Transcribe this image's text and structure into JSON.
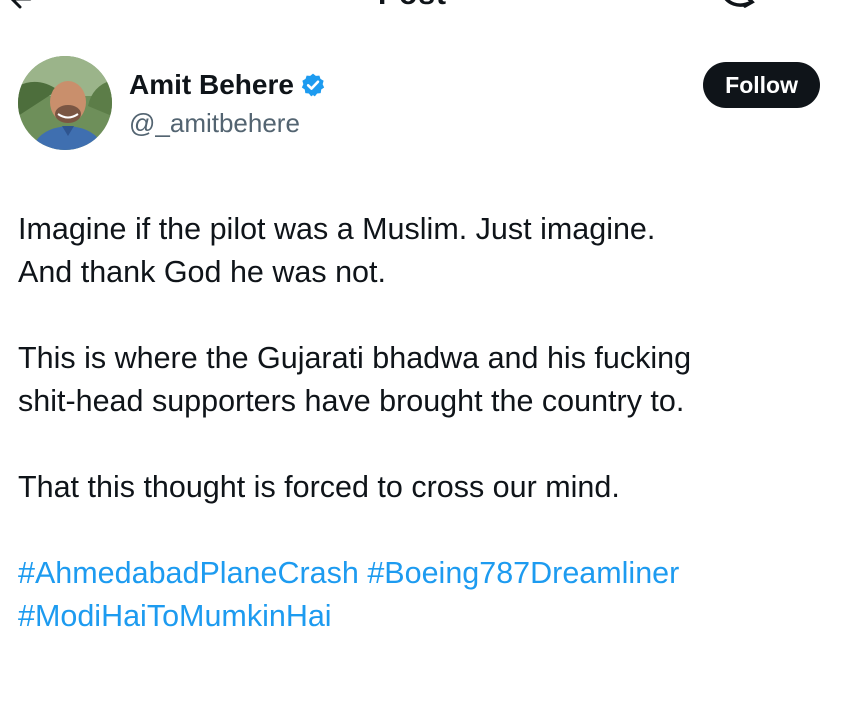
{
  "header": {
    "title": "Post"
  },
  "author": {
    "display_name": "Amit Behere",
    "handle": "@_amitbehere",
    "verified": true,
    "follow_label": "Follow"
  },
  "tweet": {
    "paragraphs": [
      {
        "lines": [
          "Imagine if the pilot was a Muslim. Just imagine.",
          "And thank God he was not."
        ]
      },
      {
        "lines": [
          "This is where the Gujarati bhadwa and his fucking",
          "shit-head supporters have brought the country to."
        ]
      },
      {
        "lines": [
          "That this thought is forced to cross our mind."
        ]
      }
    ],
    "hashtags": [
      "#AhmedabadPlaneCrash",
      "#Boeing787Dreamliner",
      "#ModiHaiToMumkinHai"
    ]
  },
  "colors": {
    "text": "#0f1419",
    "secondary_text": "#536471",
    "link": "#1d9bf0",
    "follow_button_bg": "#0f1419",
    "verified_badge": "#1d9bf0"
  },
  "icons": {
    "back": "arrow-left-icon",
    "reply": "reply-icon",
    "verified": "verified-badge-icon"
  }
}
